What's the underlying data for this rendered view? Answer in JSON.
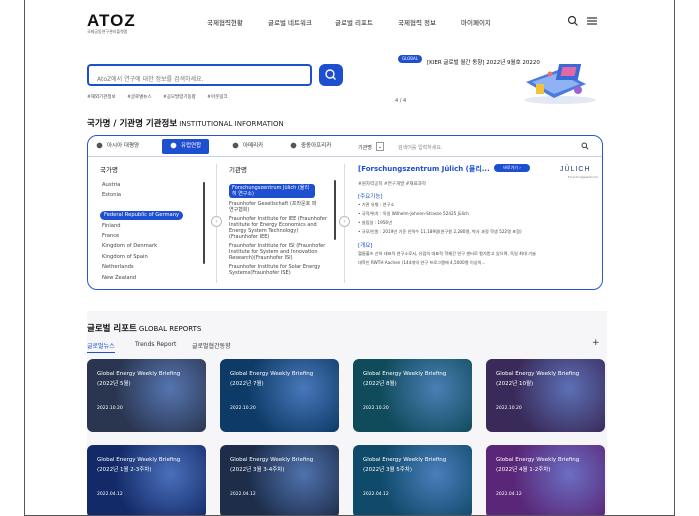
{
  "header": {
    "logo": "ATOZ",
    "logo_sub": "국제공동연구관리플랫폼",
    "nav": [
      "국제협력현황",
      "글로벌 네트워크",
      "글로벌 리포트",
      "국제협력 정보",
      "마이페이지"
    ]
  },
  "search": {
    "placeholder": "AtoZ에서 연구에 대한 정보를 검색하세요.",
    "tags": [
      "#해외기관정보",
      "#글로벌뉴스",
      "#공모발령기동향",
      "#아웃링크"
    ]
  },
  "banner": {
    "badge": "GLOBAL",
    "text": "[KIER 글로벌 월간 동향] 2022년 9월호 20220",
    "page": "4 / 4"
  },
  "institution": {
    "title": "국가명 / 기관명 기관정보",
    "title_en": "INSTITUTIONAL INFORMATION",
    "tabs": [
      "아시아 대평양",
      "유럽연합",
      "아메리카",
      "중동아프리카"
    ],
    "select_label": "기관명",
    "search_placeholder": "검색어를 입력하세요.",
    "country_header": "국가명",
    "countries": [
      "Austria",
      "Estonia",
      "Federal Republic of Germany",
      "Finland",
      "France",
      "Kingdom of Denmark",
      "Kingdom of Spain",
      "Netherlands",
      "New Zealand"
    ],
    "inst_header": "기관명",
    "institutes": [
      "Forschungszentrum Jülich (율리히 연구소)",
      "Fraunhofer Gesellschaft (프라운호 퍼연구협회)",
      "Fraunhofer Institute for IEE (Fraunhofer Institute for Energy Economics and Energy System Technology)(Fraunhofer IEE)",
      "Fraunhofer Institute for ISI (Fraunhofer Institute for System and Innovation Research)(Fraunhofer ISI)",
      "Fraunhofer Institute for Solar Energy Systems(Fraunhofer ISE)"
    ],
    "detail": {
      "title": "[Forschungszentrum Jülich (율리...",
      "btn": "바로가기 ›",
      "logo": "JÜLICH",
      "logo_sub": "Forschungszentrum",
      "sub": "#원자력공학 #연구개발 #재료과학",
      "sec1": "[주요기능]",
      "lines": [
        "• 기관 유형 : 연구소",
        "• 국적/위치 : 독일 Wilhelm-Johnen-Strasse 52425 Jülich",
        "• 설립일 : 1956년",
        "• 규모/인원 : 2019년 기준 인력수 11,189명(연구원 2,280명, 박사 과정 학생 522명 포함)"
      ],
      "sec2": "[개요]",
      "overview": [
        "헬름홀츠 산하 대표적 연구소로서, 유럽의 대표적 학제간 연구 센터로 평가받고 있으며, 독일 최대 기술",
        "대학인 RWTH Aachen (144개의 연구 프로그램에 4,5000명 이상의..."
      ]
    }
  },
  "global_reports": {
    "title": "글로벌 리포트",
    "title_en": "GLOBAL REPORTS",
    "tabs": [
      "글로벌뉴스",
      "Trends Report",
      "글로벌협간동향"
    ],
    "plus": "+",
    "cards": [
      {
        "t1": "Global Energy Weekly Briefing",
        "t2": "(2022년 5월)",
        "date": "2022.10.20",
        "bg": "#2a3550"
      },
      {
        "t1": "Global Energy Weekly Briefing",
        "t2": "(2022년 7월)",
        "date": "2022.10.20",
        "bg": "#0d3a66"
      },
      {
        "t1": "Global Energy Weekly Briefing",
        "t2": "(2022년 8월)",
        "date": "2022.10.20",
        "bg": "#104b5c"
      },
      {
        "t1": "Global Energy Weekly Briefing",
        "t2": "(2022년 10월)",
        "date": "2022.10.20",
        "bg": "#3a2a5a"
      },
      {
        "t1": "Global Energy Weekly Briefing",
        "t2": "(2022년 1월 2-3주차)",
        "date": "2022.04.12",
        "bg": "#132a68"
      },
      {
        "t1": "Global Energy Weekly Briefing",
        "t2": "(2022년 3월 3-4주차)",
        "date": "2022.04.12",
        "bg": "#1d2d4a"
      },
      {
        "t1": "Global Energy Weekly Briefing",
        "t2": "(2022년 3월 5주차)",
        "date": "2022.04.12",
        "bg": "#0f4a6a"
      },
      {
        "t1": "Global Energy Weekly Briefing",
        "t2": "(2022년 4월 1-2주차)",
        "date": "2022.04.12",
        "bg": "#5a2678"
      }
    ]
  },
  "colors": {
    "accent": "#1e4fd0"
  }
}
